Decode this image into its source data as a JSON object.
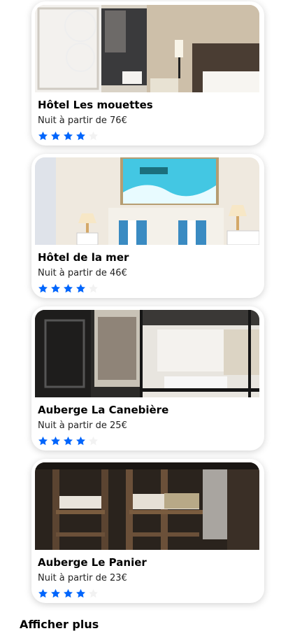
{
  "colors": {
    "star_filled": "#0065fc",
    "star_empty": "#f2f2f2"
  },
  "hotels": [
    {
      "name": "Hôtel Les mouettes",
      "price": "Nuit à partir de 76€",
      "rating": 4,
      "max_rating": 5
    },
    {
      "name": "Hôtel de la mer",
      "price": "Nuit à partir de 46€",
      "rating": 4,
      "max_rating": 5
    },
    {
      "name": "Auberge La Canebière",
      "price": "Nuit à partir de 25€",
      "rating": 4,
      "max_rating": 5
    },
    {
      "name": "Auberge Le Panier",
      "price": "Nuit à partir de 23€",
      "rating": 4,
      "max_rating": 5
    }
  ],
  "show_more_label": "Afficher plus"
}
